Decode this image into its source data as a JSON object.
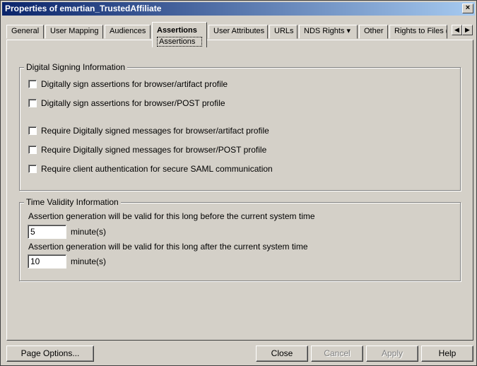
{
  "window": {
    "title": "Properties of emartian_TrustedAffiliate",
    "close_glyph": "×"
  },
  "tabs": [
    {
      "label": "General"
    },
    {
      "label": "User Mapping"
    },
    {
      "label": "Audiences"
    },
    {
      "label": "Assertions",
      "sub_label": "Assertions",
      "active": true
    },
    {
      "label": "User Attributes"
    },
    {
      "label": "URLs"
    },
    {
      "label": "NDS Rights ▾"
    },
    {
      "label": "Other"
    },
    {
      "label": "Rights to Files ("
    }
  ],
  "tab_scroll": {
    "left": "◀",
    "right": "▶"
  },
  "signing": {
    "title": "Digital Signing Information",
    "options": [
      {
        "label": "Digitally sign assertions for browser/artifact profile",
        "checked": false
      },
      {
        "label": "Digitally sign assertions for browser/POST profile",
        "checked": false
      },
      {
        "label": "Require Digitally signed messages for browser/artifact profile",
        "checked": false
      },
      {
        "label": "Require Digitally signed messages for browser/POST profile",
        "checked": false
      },
      {
        "label": "Require client authentication for secure SAML communication",
        "checked": false
      }
    ]
  },
  "validity": {
    "title": "Time Validity Information",
    "before_label": "Assertion generation will be valid for this long before the current system time",
    "before_value": "5",
    "after_label": "Assertion generation will be valid for this long after the current system time",
    "after_value": "10",
    "unit": "minute(s)"
  },
  "buttons": {
    "page_options": "Page Options...",
    "close": "Close",
    "cancel": "Cancel",
    "apply": "Apply",
    "help": "Help"
  }
}
